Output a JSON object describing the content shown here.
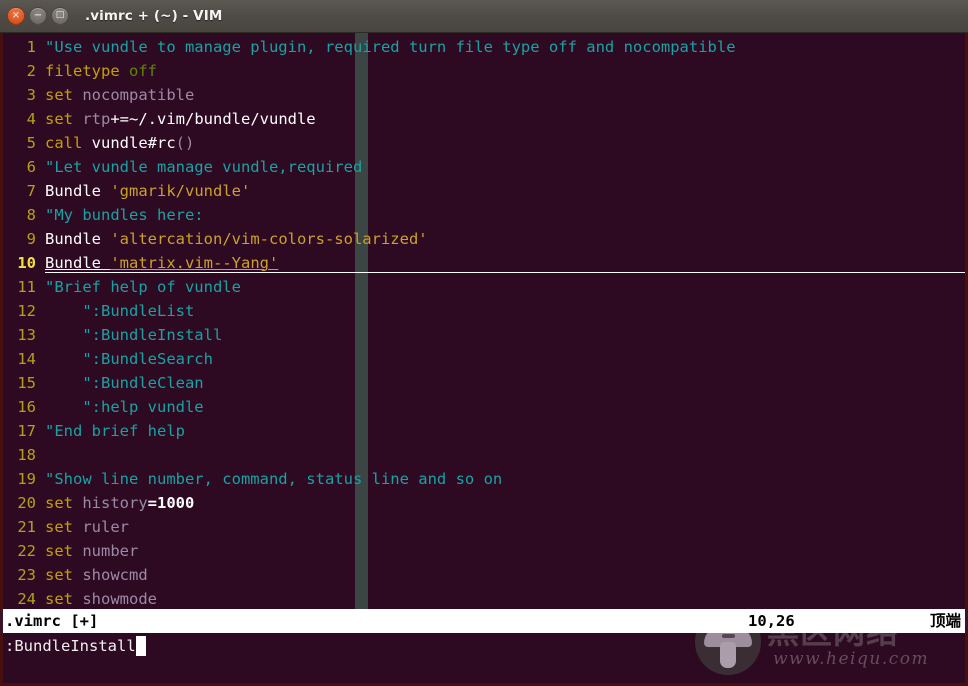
{
  "window": {
    "title": ".vimrc + (~) - VIM",
    "controls": [
      {
        "name": "close",
        "glyph": "×"
      },
      {
        "name": "minimize",
        "glyph": "−"
      },
      {
        "name": "maximize",
        "glyph": "□"
      }
    ]
  },
  "editor": {
    "colorcolumn_x": 352,
    "cursor_line": 10,
    "lines": [
      {
        "n": "1",
        "tokens": [
          {
            "t": "comment",
            "s": "\"Use vundle to manage plugin, required turn file type off and nocompatible"
          }
        ]
      },
      {
        "n": "2",
        "tokens": [
          {
            "t": "stmt",
            "s": "filetype"
          },
          {
            "t": "norm",
            "s": " "
          },
          {
            "t": "const",
            "s": "off"
          }
        ]
      },
      {
        "n": "3",
        "tokens": [
          {
            "t": "stmt",
            "s": "set"
          },
          {
            "t": "norm",
            "s": " "
          },
          {
            "t": "option",
            "s": "nocompatible"
          }
        ]
      },
      {
        "n": "4",
        "tokens": [
          {
            "t": "stmt",
            "s": "set"
          },
          {
            "t": "norm",
            "s": " "
          },
          {
            "t": "option",
            "s": "rtp"
          },
          {
            "t": "ident",
            "s": "+=~/.vim/bundle/vundle"
          }
        ]
      },
      {
        "n": "5",
        "tokens": [
          {
            "t": "stmt",
            "s": "call"
          },
          {
            "t": "norm",
            "s": " "
          },
          {
            "t": "ident",
            "s": "vundle#rc"
          },
          {
            "t": "paren",
            "s": "()"
          }
        ]
      },
      {
        "n": "6",
        "tokens": [
          {
            "t": "comment",
            "s": "\"Let vundle manage vundle,required"
          }
        ]
      },
      {
        "n": "7",
        "tokens": [
          {
            "t": "ident",
            "s": "Bundle"
          },
          {
            "t": "norm",
            "s": " "
          },
          {
            "t": "string",
            "s": "'gmarik/vundle'"
          }
        ]
      },
      {
        "n": "8",
        "tokens": [
          {
            "t": "comment",
            "s": "\"My bundles here:"
          }
        ]
      },
      {
        "n": "9",
        "tokens": [
          {
            "t": "ident",
            "s": "Bundle"
          },
          {
            "t": "norm",
            "s": " "
          },
          {
            "t": "string",
            "s": "'altercation/vim-colors-solarized'"
          }
        ]
      },
      {
        "n": "10",
        "cursorline": true,
        "tokens": [
          {
            "t": "ident",
            "s": "Bundle"
          },
          {
            "t": "norm",
            "s": " "
          },
          {
            "t": "string",
            "s": "'matrix.vim--Yang'"
          }
        ]
      },
      {
        "n": "11",
        "tokens": [
          {
            "t": "comment",
            "s": "\"Brief help of vundle"
          }
        ]
      },
      {
        "n": "12",
        "tokens": [
          {
            "t": "comment",
            "s": "    \":BundleList"
          }
        ]
      },
      {
        "n": "13",
        "tokens": [
          {
            "t": "comment",
            "s": "    \":BundleInstall"
          }
        ]
      },
      {
        "n": "14",
        "tokens": [
          {
            "t": "comment",
            "s": "    \":BundleSearch"
          }
        ]
      },
      {
        "n": "15",
        "tokens": [
          {
            "t": "comment",
            "s": "    \":BundleClean"
          }
        ]
      },
      {
        "n": "16",
        "tokens": [
          {
            "t": "comment",
            "s": "    \":help vundle"
          }
        ]
      },
      {
        "n": "17",
        "tokens": [
          {
            "t": "comment",
            "s": "\"End brief help"
          }
        ]
      },
      {
        "n": "18",
        "tokens": [
          {
            "t": "norm",
            "s": ""
          }
        ]
      },
      {
        "n": "19",
        "tokens": [
          {
            "t": "comment",
            "s": "\"Show line number, command, status line and so on"
          }
        ]
      },
      {
        "n": "20",
        "tokens": [
          {
            "t": "stmt",
            "s": "set"
          },
          {
            "t": "norm",
            "s": " "
          },
          {
            "t": "option",
            "s": "history"
          },
          {
            "t": "num",
            "s": "=1000"
          }
        ]
      },
      {
        "n": "21",
        "tokens": [
          {
            "t": "stmt",
            "s": "set"
          },
          {
            "t": "norm",
            "s": " "
          },
          {
            "t": "option",
            "s": "ruler"
          }
        ]
      },
      {
        "n": "22",
        "tokens": [
          {
            "t": "stmt",
            "s": "set"
          },
          {
            "t": "norm",
            "s": " "
          },
          {
            "t": "option",
            "s": "number"
          }
        ]
      },
      {
        "n": "23",
        "tokens": [
          {
            "t": "stmt",
            "s": "set"
          },
          {
            "t": "norm",
            "s": " "
          },
          {
            "t": "option",
            "s": "showcmd"
          }
        ]
      },
      {
        "n": "24",
        "tokens": [
          {
            "t": "stmt",
            "s": "set"
          },
          {
            "t": "norm",
            "s": " "
          },
          {
            "t": "option",
            "s": "showmode"
          }
        ]
      }
    ]
  },
  "statusline": {
    "filename": ".vimrc [+]",
    "ruler": "10,26",
    "position": "顶端"
  },
  "commandline": {
    "text": ":BundleInstall"
  },
  "watermark": {
    "cn": "黑区网络",
    "url": "www.heiqu.com"
  },
  "colors": {
    "bg": "#2d0a22",
    "titlebar": "#4e4a45",
    "linenumber": "#b5a01a",
    "comment": "#16a3a3",
    "statement": "#c4a000",
    "option": "#9b8aa6",
    "string": "#c9a227",
    "constant": "#5f8700",
    "colorcolumn": "#3b4543",
    "statusline_bg": "#ffffff",
    "statusline_fg": "#000000",
    "border": "#47100f"
  }
}
